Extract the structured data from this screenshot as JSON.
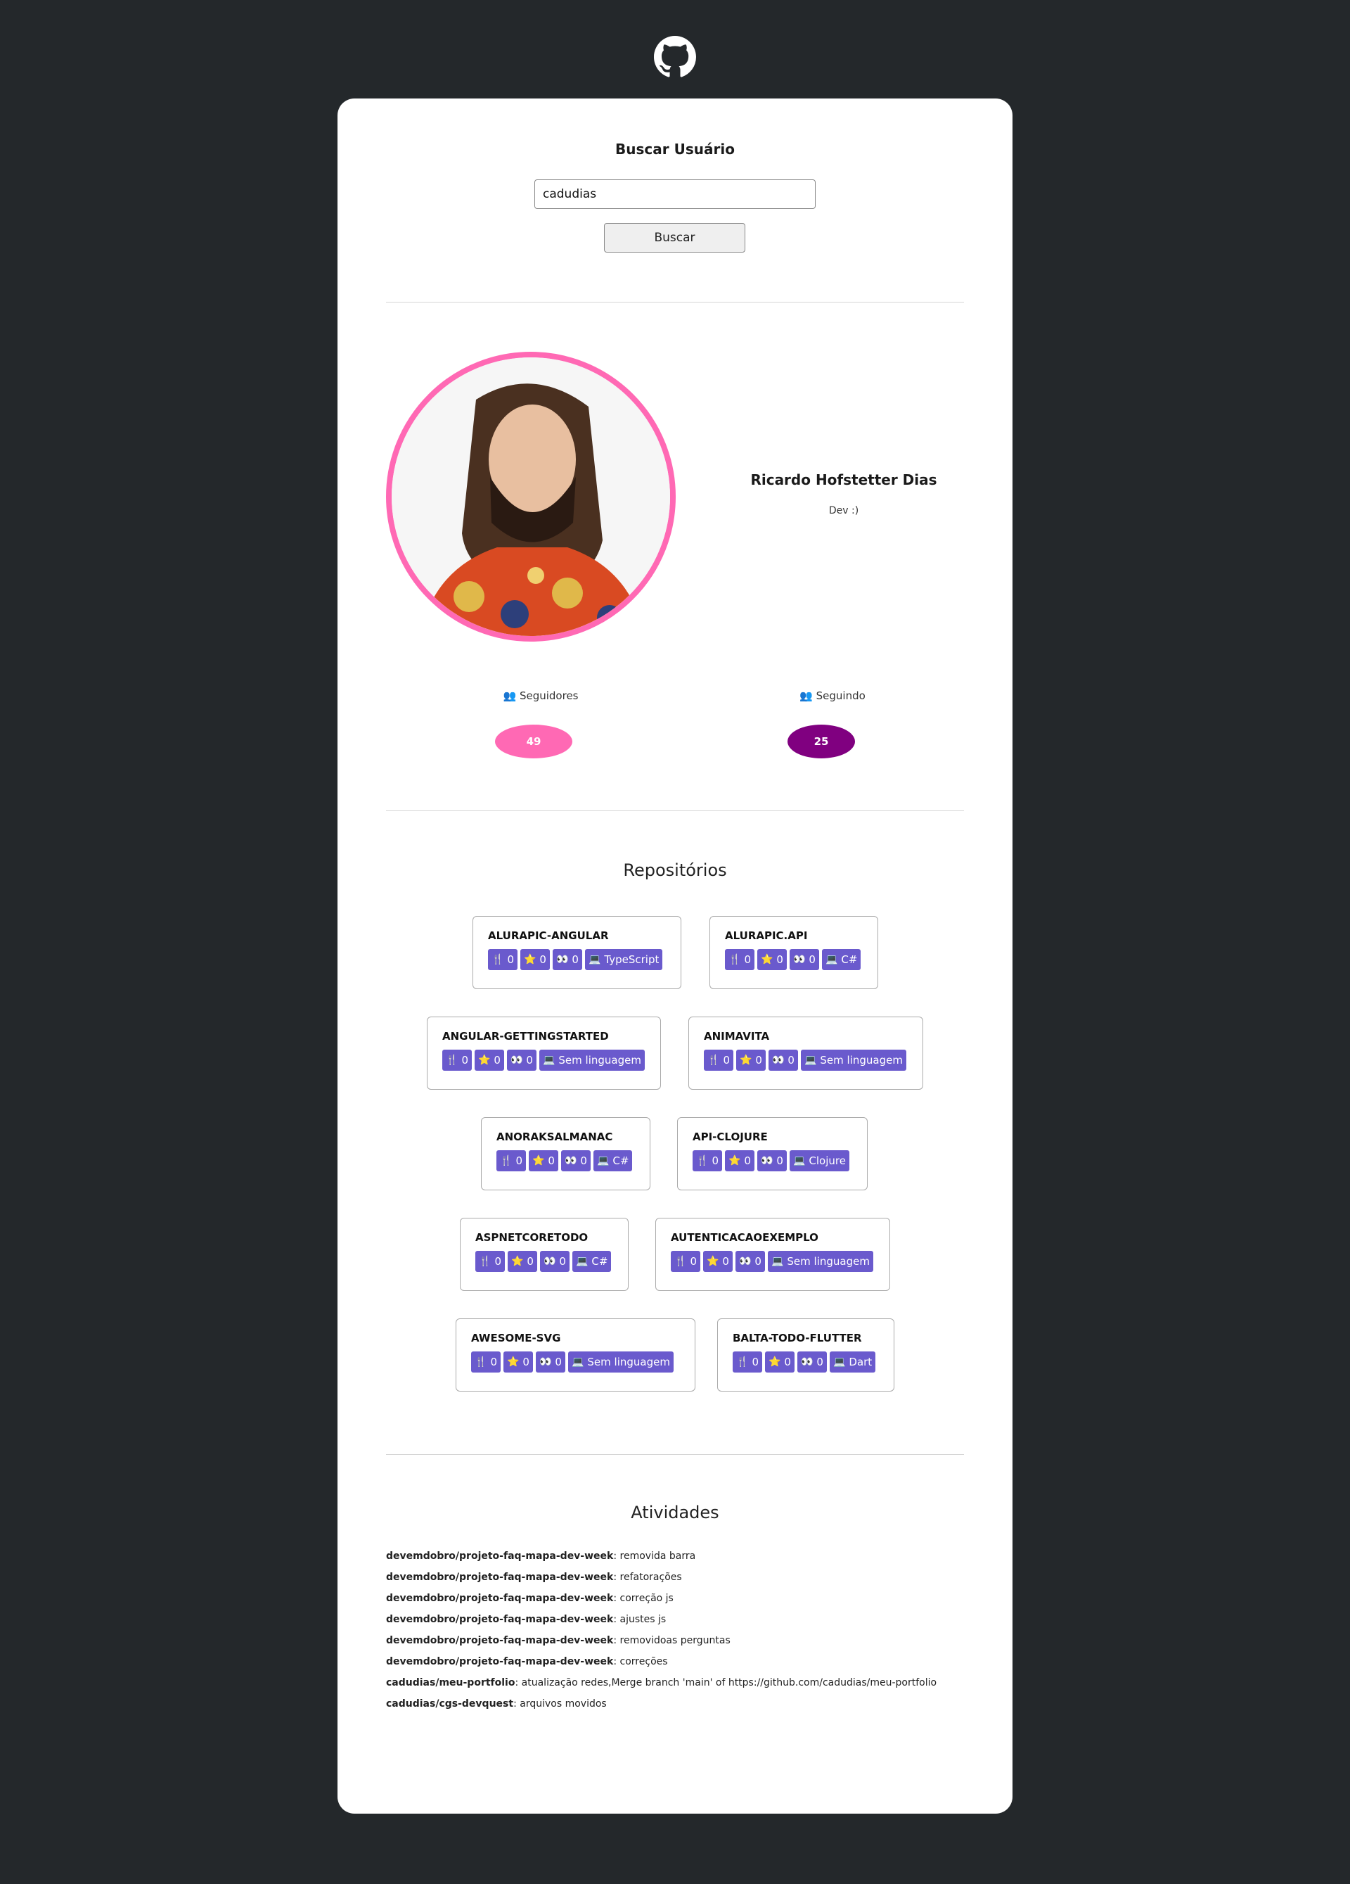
{
  "search": {
    "title": "Buscar Usuário",
    "input_value": "cadudias",
    "button_label": "Buscar"
  },
  "profile": {
    "name": "Ricardo Hofstetter Dias",
    "bio": "Dev :)"
  },
  "stats": {
    "followers_label": "Seguidores",
    "followers_value": "49",
    "following_label": "Seguindo",
    "following_value": "25"
  },
  "repos": {
    "title": "Repositórios",
    "items": [
      {
        "name": "ALURAPIC-ANGULAR",
        "forks": "0",
        "stars": "0",
        "watchers": "0",
        "language": "TypeScript"
      },
      {
        "name": "ALURAPIC.API",
        "forks": "0",
        "stars": "0",
        "watchers": "0",
        "language": "C#"
      },
      {
        "name": "ANGULAR-GETTINGSTARTED",
        "forks": "0",
        "stars": "0",
        "watchers": "0",
        "language": "Sem linguagem"
      },
      {
        "name": "ANIMAVITA",
        "forks": "0",
        "stars": "0",
        "watchers": "0",
        "language": "Sem linguagem"
      },
      {
        "name": "ANORAKSALMANAC",
        "forks": "0",
        "stars": "0",
        "watchers": "0",
        "language": "C#"
      },
      {
        "name": "API-CLOJURE",
        "forks": "0",
        "stars": "0",
        "watchers": "0",
        "language": "Clojure"
      },
      {
        "name": "ASPNETCORETODO",
        "forks": "0",
        "stars": "0",
        "watchers": "0",
        "language": "C#"
      },
      {
        "name": "AUTENTICACAOEXEMPLO",
        "forks": "0",
        "stars": "0",
        "watchers": "0",
        "language": "Sem linguagem"
      },
      {
        "name": "AWESOME-SVG",
        "forks": "0",
        "stars": "0",
        "watchers": "0",
        "language": "Sem linguagem"
      },
      {
        "name": "BALTA-TODO-FLUTTER",
        "forks": "0",
        "stars": "0",
        "watchers": "0",
        "language": "Dart"
      }
    ]
  },
  "activities": {
    "title": "Atividades",
    "items": [
      {
        "repo": "devemdobro/projeto-faq-mapa-dev-week",
        "message": "removida barra"
      },
      {
        "repo": "devemdobro/projeto-faq-mapa-dev-week",
        "message": "refatorações"
      },
      {
        "repo": "devemdobro/projeto-faq-mapa-dev-week",
        "message": "correção js"
      },
      {
        "repo": "devemdobro/projeto-faq-mapa-dev-week",
        "message": "ajustes js"
      },
      {
        "repo": "devemdobro/projeto-faq-mapa-dev-week",
        "message": "removidoas perguntas"
      },
      {
        "repo": "devemdobro/projeto-faq-mapa-dev-week",
        "message": "correções"
      },
      {
        "repo": "cadudias/meu-portfolio",
        "message": "atualização redes,Merge branch 'main' of https://github.com/cadudias/meu-portfolio"
      },
      {
        "repo": "cadudias/cgs-devquest",
        "message": "arquivos movidos"
      }
    ]
  },
  "colors": {
    "followers_pill": "#ff69b4",
    "following_pill": "#800080",
    "badge": "#6a5acd",
    "avatar_border": "#ff69b4"
  }
}
